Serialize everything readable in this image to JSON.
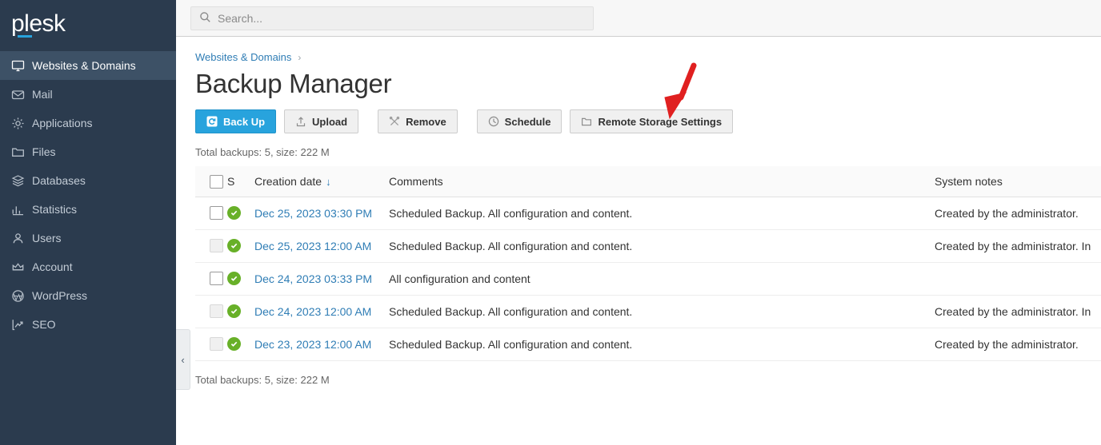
{
  "sidebar": {
    "logo": "plesk",
    "items": [
      {
        "label": "Websites & Domains",
        "icon": "monitor-icon",
        "active": true
      },
      {
        "label": "Mail",
        "icon": "envelope-icon",
        "active": false
      },
      {
        "label": "Applications",
        "icon": "gear-icon",
        "active": false
      },
      {
        "label": "Files",
        "icon": "folder-icon",
        "active": false
      },
      {
        "label": "Databases",
        "icon": "database-stack-icon",
        "active": false
      },
      {
        "label": "Statistics",
        "icon": "bar-chart-icon",
        "active": false
      },
      {
        "label": "Users",
        "icon": "user-icon",
        "active": false
      },
      {
        "label": "Account",
        "icon": "crown-icon",
        "active": false
      },
      {
        "label": "WordPress",
        "icon": "wordpress-icon",
        "active": false
      },
      {
        "label": "SEO",
        "icon": "seo-trend-icon",
        "active": false
      }
    ],
    "collapse_label": "‹"
  },
  "topbar": {
    "search_placeholder": "Search...",
    "search_value": ""
  },
  "breadcrumb": {
    "items": [
      "Websites & Domains"
    ],
    "separator": "›"
  },
  "page": {
    "title": "Backup Manager",
    "total_top": "Total backups: 5, size: 222 M",
    "total_bottom": "Total backups: 5, size: 222 M"
  },
  "toolbar": {
    "buttons": [
      {
        "label": "Back Up",
        "icon": "backup-disk-icon",
        "primary": true
      },
      {
        "label": "Upload",
        "icon": "upload-icon",
        "primary": false
      },
      {
        "label": "Remove",
        "icon": "remove-x-icon",
        "primary": false
      },
      {
        "label": "Schedule",
        "icon": "clock-icon",
        "primary": false
      },
      {
        "label": "Remote Storage Settings",
        "icon": "folder-settings-icon",
        "primary": false
      }
    ]
  },
  "annotation": {
    "type": "red-arrow",
    "color": "#e02020",
    "points_to": "Schedule"
  },
  "table": {
    "columns": [
      "",
      "S",
      "Creation date",
      "Comments",
      "System notes"
    ],
    "sort_column": "Creation date",
    "sort_direction": "↓",
    "rows": [
      {
        "checkbox_enabled": true,
        "status": "ok",
        "date": "Dec 25, 2023 03:30 PM",
        "comments": "Scheduled Backup. All configuration and content.",
        "notes": "Created by the administrator."
      },
      {
        "checkbox_enabled": false,
        "status": "ok",
        "date": "Dec 25, 2023 12:00 AM",
        "comments": "Scheduled Backup. All configuration and content.",
        "notes": "Created by the administrator. In"
      },
      {
        "checkbox_enabled": true,
        "status": "ok",
        "date": "Dec 24, 2023 03:33 PM",
        "comments": "All configuration and content",
        "notes": ""
      },
      {
        "checkbox_enabled": false,
        "status": "ok",
        "date": "Dec 24, 2023 12:00 AM",
        "comments": "Scheduled Backup. All configuration and content.",
        "notes": "Created by the administrator. In"
      },
      {
        "checkbox_enabled": false,
        "status": "ok",
        "date": "Dec 23, 2023 12:00 AM",
        "comments": "Scheduled Backup. All configuration and content.",
        "notes": "Created by the administrator."
      }
    ]
  },
  "colors": {
    "sidebar_bg": "#2b3b4e",
    "sidebar_active_bg": "#3d5166",
    "accent_blue": "#28a3dd",
    "link_blue": "#2f7db5",
    "status_green": "#68b028",
    "annotation_red": "#e02020"
  }
}
